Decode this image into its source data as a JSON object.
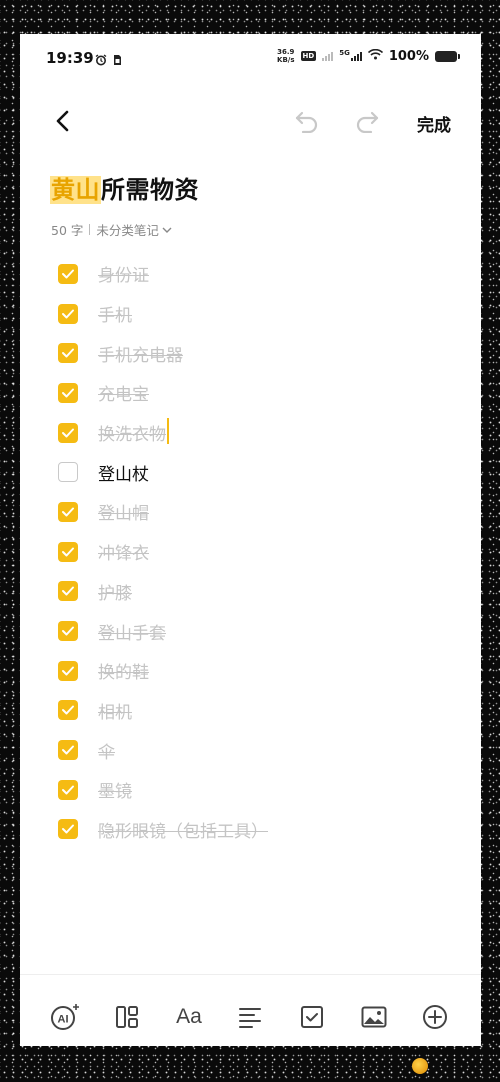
{
  "status_bar": {
    "time": "19:39",
    "speed_value": "36.9",
    "speed_unit": "KB/s",
    "hd_label": "HD",
    "network_label": "5G",
    "battery": "100%"
  },
  "toolbar": {
    "done_label": "完成"
  },
  "note": {
    "title_highlight": "黄山",
    "title_rest": "所需物资",
    "word_count": "50 字",
    "category": "未分类笔记"
  },
  "checklist": [
    {
      "text": "身份证",
      "checked": true
    },
    {
      "text": "手机",
      "checked": true
    },
    {
      "text": "手机充电器",
      "checked": true
    },
    {
      "text": "充电宝",
      "checked": true
    },
    {
      "text": "换洗衣物",
      "checked": true
    },
    {
      "text": "登山杖",
      "checked": false
    },
    {
      "text": "登山帽",
      "checked": true
    },
    {
      "text": "冲锋衣",
      "checked": true
    },
    {
      "text": "护膝",
      "checked": true
    },
    {
      "text": "登山手套",
      "checked": true
    },
    {
      "text": "换的鞋",
      "checked": true
    },
    {
      "text": "相机",
      "checked": true
    },
    {
      "text": "伞",
      "checked": true
    },
    {
      "text": "墨镜",
      "checked": true
    },
    {
      "text": "隐形眼镜（包括工具）",
      "checked": true
    }
  ],
  "bottom_bar": {
    "ai_label": "AI",
    "font_label": "Aa"
  },
  "colors": {
    "accent": "#f5bb13",
    "highlight_bg": "#ffe28a",
    "done_text": "#c4c4c4"
  },
  "icons": [
    "back-arrow-icon",
    "undo-icon",
    "redo-icon",
    "chevron-down-icon",
    "check-icon",
    "ai-icon",
    "layout-icon",
    "text-align-icon",
    "checkbox-icon",
    "image-icon",
    "add-circle-icon",
    "alarm-icon",
    "sim-icon",
    "wifi-icon",
    "battery-icon"
  ]
}
